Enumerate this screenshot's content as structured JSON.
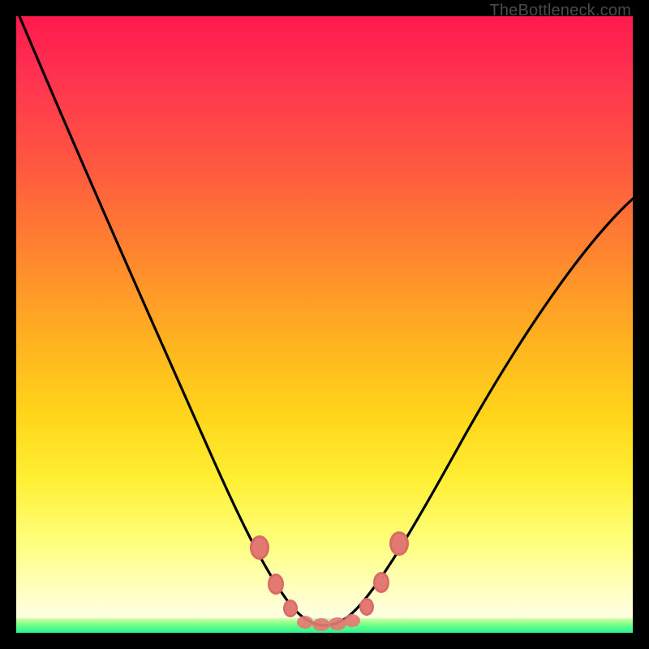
{
  "watermark": "TheBottleneck.com",
  "colors": {
    "frame": "#000000",
    "gradient_top": "#ff1a4d",
    "gradient_mid": "#ffd61a",
    "gradient_bottom": "#fffff0",
    "green_band_top": "#d6ffb0",
    "green_band_bottom": "#20f58f",
    "curve": "#000000",
    "marker_fill": "#e47b74"
  },
  "chart_data": {
    "type": "line",
    "title": "",
    "xlabel": "",
    "ylabel": "",
    "xlim": [
      0,
      100
    ],
    "ylim": [
      0,
      100
    ],
    "x": [
      0,
      5,
      10,
      15,
      20,
      25,
      30,
      35,
      38,
      41,
      44,
      47,
      50,
      53,
      56,
      60,
      65,
      70,
      75,
      80,
      85,
      90,
      95,
      100
    ],
    "values": [
      100,
      90,
      80,
      69,
      58,
      47,
      36,
      25,
      16,
      9,
      4,
      1.5,
      1,
      1.5,
      3,
      7,
      15,
      24,
      33,
      41,
      48,
      55,
      61,
      67
    ],
    "markers_x": [
      38.5,
      41,
      44,
      47,
      50,
      53,
      56,
      59,
      61.5
    ],
    "markers_y": [
      15,
      8,
      3.5,
      1.5,
      1,
      1.5,
      3,
      7,
      13
    ],
    "notes": "V-shaped bottleneck curve. Y is bottleneck percentage (0 = ideal, at green band). Minimum around x≈50. Left branch reaches 100% at x=0; right branch exits at ~67% at x=100. Markers are salmon dots clustered near the trough."
  }
}
